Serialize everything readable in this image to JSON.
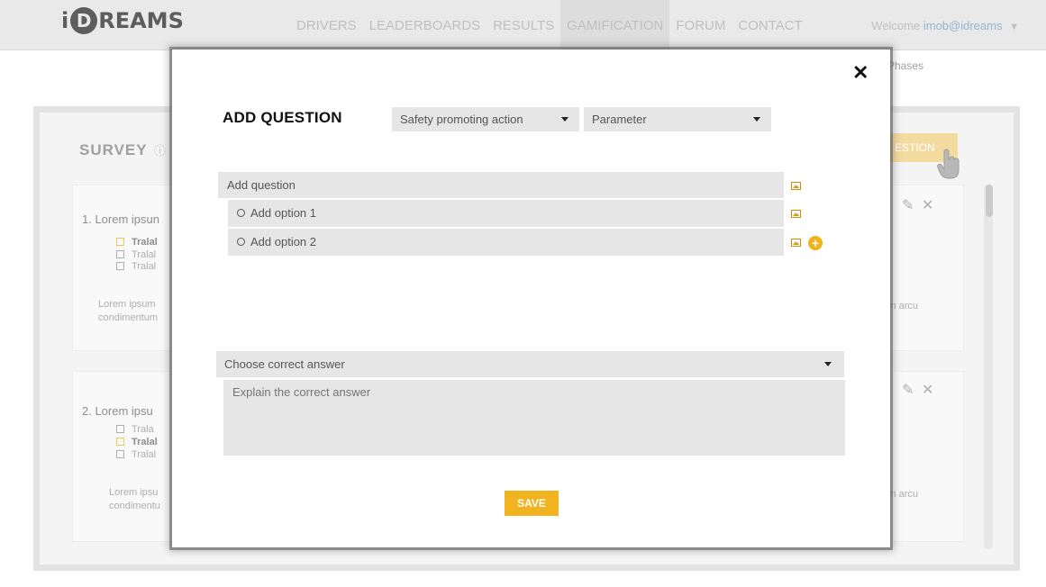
{
  "header": {
    "logo_i": "i",
    "logo_d": "D",
    "logo_rest": "REAMS",
    "nav": [
      "DRIVERS",
      "LEADERBOARDS",
      "RESULTS",
      "GAMIFICATION",
      "FORUM",
      "CONTACT"
    ],
    "active_nav": "GAMIFICATION",
    "welcome_prefix": "Welcome",
    "welcome_user": "imob@idreams",
    "dropdown_caret": "▼"
  },
  "background": {
    "phases_label": "Phases",
    "survey_title": "SURVEY",
    "info_glyph": "ⓘ",
    "add_question_btn": "ESTION",
    "questions": [
      {
        "title": "1. Lorem ipsun",
        "options": [
          "Tralal",
          "Tralal",
          "Tralal"
        ],
        "desc_line1": "Lorem ipsum",
        "desc_line2": "condimentum",
        "desc_right": "m arcu"
      },
      {
        "title": "2.   Lorem ipsu",
        "options": [
          "Trala",
          "Tralal",
          "Tralal"
        ],
        "desc_line1": "Lorem ipsu",
        "desc_line2": "condimentu",
        "desc_right": "sim arcu"
      }
    ]
  },
  "modal": {
    "close_glyph": "✕",
    "title": "ADD QUESTION",
    "category_select": "Safety promoting action",
    "parameter_select": "Parameter",
    "question_placeholder": "Add question",
    "option1": "Add option 1",
    "option2": "Add option 2",
    "add_option_glyph": "+",
    "correct_answer_select": "Choose correct answer",
    "explain_placeholder": "Explain the correct answer",
    "save_label": "SAVE"
  },
  "colors": {
    "accent": "#f2b321",
    "field_bg": "#e6e6e6",
    "header_bg": "#e8e8e8"
  },
  "icons": [
    "close-icon",
    "image-icon",
    "add-circle-icon",
    "pencil-icon",
    "delete-icon",
    "hand-pointer-icon",
    "info-icon",
    "caret-down-icon"
  ]
}
